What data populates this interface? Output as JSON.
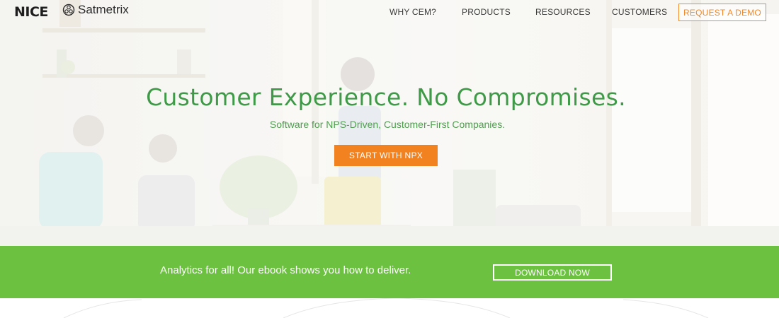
{
  "header": {
    "logo_primary": "NICE",
    "logo_secondary": "Satmetrix",
    "nav": [
      {
        "label": "WHY CEM?"
      },
      {
        "label": "PRODUCTS"
      },
      {
        "label": "RESOURCES"
      },
      {
        "label": "CUSTOMERS"
      }
    ],
    "demo_button": "REQUEST A DEMO"
  },
  "hero": {
    "headline": "Customer Experience. No Compromises.",
    "subheadline": "Software for NPS-Driven, Customer-First Companies.",
    "cta_button": "START WITH NPX"
  },
  "promo": {
    "text": "Analytics for all! Our ebook shows you how to deliver.",
    "button": "DOWNLOAD NOW"
  },
  "colors": {
    "brand_green": "#3f9a48",
    "promo_green": "#6cc140",
    "accent_orange": "#f2811f"
  },
  "icons": {
    "satmetrix_logo": "satmetrix-logo-icon"
  }
}
